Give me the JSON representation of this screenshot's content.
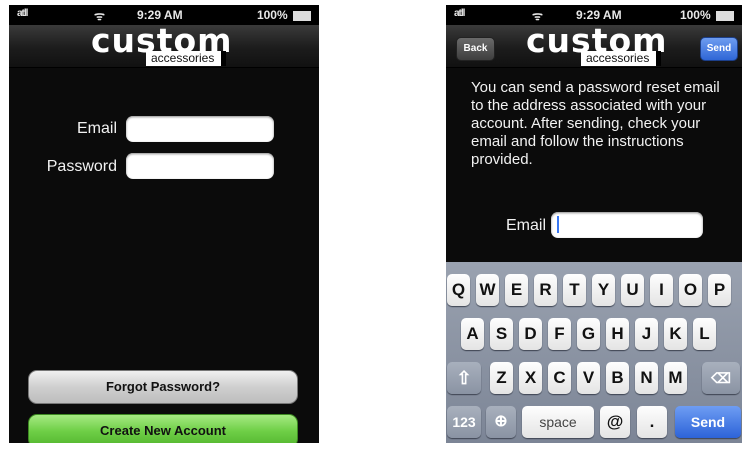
{
  "status_bar": {
    "signal": "atll",
    "time": "9:29 AM",
    "battery": "100%"
  },
  "logo": {
    "main": "custom",
    "sub": "accessories"
  },
  "login_screen": {
    "email_label": "Email",
    "password_label": "Password",
    "forgot_button": "Forgot Password?",
    "create_button": "Create New Account"
  },
  "reset_screen": {
    "back_button": "Back",
    "send_button": "Send",
    "instructions": "You can send a password reset email to the address associated with your account.  After sending, check your email and follow the instructions provided.",
    "email_label": "Email"
  },
  "keyboard": {
    "row1": [
      "Q",
      "W",
      "E",
      "R",
      "T",
      "Y",
      "U",
      "I",
      "O",
      "P"
    ],
    "row2": [
      "A",
      "S",
      "D",
      "F",
      "G",
      "H",
      "J",
      "K",
      "L"
    ],
    "row3": [
      "Z",
      "X",
      "C",
      "V",
      "B",
      "N",
      "M"
    ],
    "numbers_key": "123",
    "space_key": "space",
    "at_key": "@",
    "dot_key": ".",
    "send_key": "Send"
  },
  "icons": {
    "wifi": "wifi-icon",
    "battery": "battery-icon",
    "shift": "shift-icon",
    "delete": "delete-icon",
    "globe": "globe-icon"
  },
  "colors": {
    "accent_blue": "#2f66d6",
    "green_button": "#6fcf47",
    "background": "#0b0b0b"
  }
}
